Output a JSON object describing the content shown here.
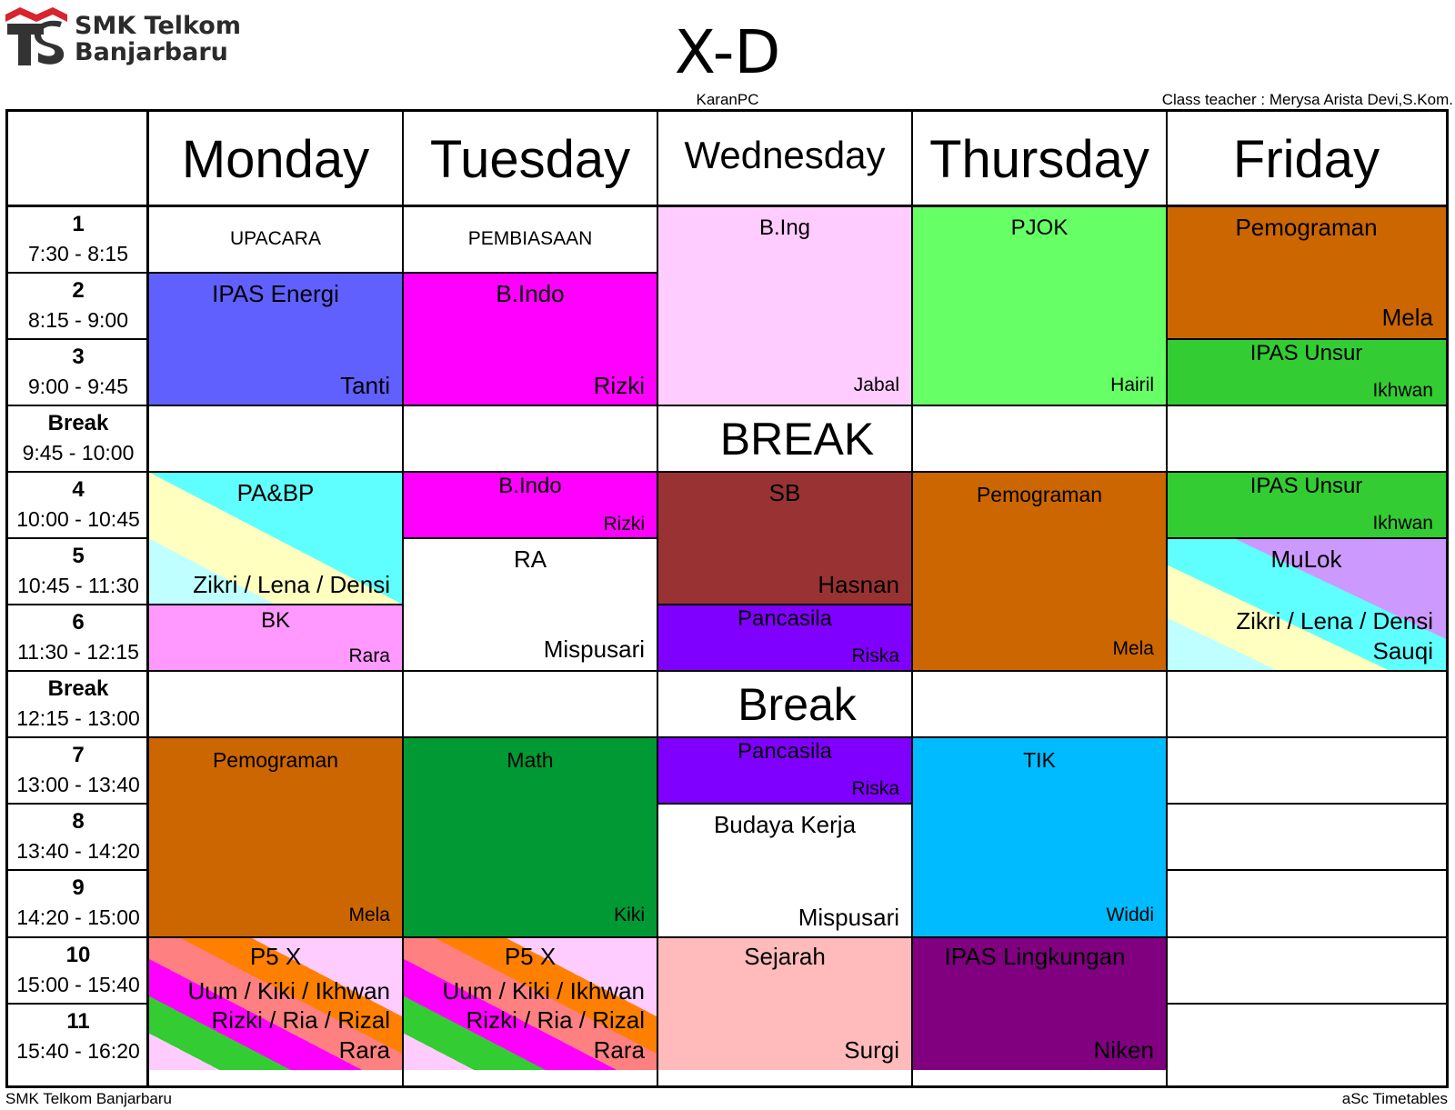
{
  "school": {
    "logo_line1": "SMK Telkom",
    "logo_line2": "Banjarbaru",
    "logo_icon": "telkom-school-logo",
    "accent": "#d9232d"
  },
  "class": {
    "name": "X-D",
    "author": "KaranPC",
    "teacher_label": "Class teacher : Merysa Arista Devi,S.Kom."
  },
  "days": [
    "Monday",
    "Tuesday",
    "Wednesday",
    "Thursday",
    "Friday"
  ],
  "periods": [
    {
      "num": "1",
      "time": "7:30 - 8:15"
    },
    {
      "num": "2",
      "time": "8:15 - 9:00"
    },
    {
      "num": "3",
      "time": "9:00 - 9:45"
    },
    {
      "num": "Break",
      "time": "9:45 - 10:00"
    },
    {
      "num": "4",
      "time": "10:00 - 10:45"
    },
    {
      "num": "5",
      "time": "10:45 - 11:30"
    },
    {
      "num": "6",
      "time": "11:30 - 12:15"
    },
    {
      "num": "Break",
      "time": "12:15 - 13:00"
    },
    {
      "num": "7",
      "time": "13:00 - 13:40"
    },
    {
      "num": "8",
      "time": "13:40 - 14:20"
    },
    {
      "num": "9",
      "time": "14:20 - 15:00"
    },
    {
      "num": "10",
      "time": "15:00 - 15:40"
    },
    {
      "num": "11",
      "time": "15:40 - 16:20"
    }
  ],
  "breaks": {
    "first": "BREAK",
    "second": "Break"
  },
  "lessons": {
    "mon_upacara": {
      "subject": "UPACARA"
    },
    "mon_ipas": {
      "subject": "IPAS Energi",
      "teacher": "Tanti",
      "color": "#6060ff"
    },
    "mon_pabp": {
      "subject": "PA&BP",
      "teacher": "Zikri / Lena / Densi",
      "colors": [
        "#c0ffff",
        "#ffffc0",
        "#60ffff"
      ]
    },
    "mon_bk": {
      "subject": "BK",
      "teacher": "Rara",
      "color": "#ff99ff"
    },
    "mon_pemo": {
      "subject": "Pemograman",
      "teacher": "Mela",
      "color": "#cc6600"
    },
    "mon_p5": {
      "subject": "P5 X",
      "line2": "Uum / Kiki / Ikhwan",
      "line3": "Rizki / Ria / Rizal",
      "teacher": "Rara",
      "colors": [
        "#ffccff",
        "#33cc33",
        "#ff00ff",
        "#ff8080",
        "#ff8000"
      ]
    },
    "tue_pembiasaan": {
      "subject": "PEMBIASAAN"
    },
    "tue_bindo1": {
      "subject": "B.Indo",
      "teacher": "Rizki",
      "color": "#ff00ff"
    },
    "tue_bindo2": {
      "subject": "B.Indo",
      "teacher": "Rizki",
      "color": "#ff00ff"
    },
    "tue_ra": {
      "subject": "RA",
      "teacher": "Mispusari"
    },
    "tue_math": {
      "subject": "Math",
      "teacher": "Kiki",
      "color": "#009933"
    },
    "tue_p5": {
      "subject": "P5 X",
      "line2": "Uum / Kiki / Ikhwan",
      "line3": "Rizki / Ria / Rizal",
      "teacher": "Rara"
    },
    "wed_bing": {
      "subject": "B.Ing",
      "teacher": "Jabal",
      "color": "#ffccff"
    },
    "wed_sb": {
      "subject": "SB",
      "teacher": "Hasnan",
      "color": "#993333"
    },
    "wed_pancasila1": {
      "subject": "Pancasila",
      "teacher": "Riska",
      "color": "#8000ff"
    },
    "wed_pancasila2": {
      "subject": "Pancasila",
      "teacher": "Riska",
      "color": "#8000ff"
    },
    "wed_budaya": {
      "subject": "Budaya Kerja",
      "teacher": "Mispusari"
    },
    "wed_sejarah": {
      "subject": "Sejarah",
      "teacher": "Surgi",
      "color": "#ffbbbb"
    },
    "thu_pjok": {
      "subject": "PJOK",
      "teacher": "Hairil",
      "color": "#66ff66"
    },
    "thu_pemo": {
      "subject": "Pemograman",
      "teacher": "Mela",
      "color": "#cc6600"
    },
    "thu_tik": {
      "subject": "TIK",
      "teacher": "Widdi",
      "color": "#00bbff"
    },
    "thu_ipasling": {
      "subject": "IPAS Lingkungan",
      "teacher": "Niken",
      "color": "#800080"
    },
    "fri_pemo": {
      "subject": "Pemograman",
      "teacher": "Mela",
      "color": "#cc6600"
    },
    "fri_ipas1": {
      "subject": "IPAS Unsur",
      "teacher": "Ikhwan",
      "color": "#33cc33"
    },
    "fri_ipas2": {
      "subject": "IPAS Unsur",
      "teacher": "Ikhwan",
      "color": "#33cc33"
    },
    "fri_mulok": {
      "subject": "MuLok",
      "teacher": "Zikri / Lena / Densi",
      "teacher2": "Sauqi",
      "colors": [
        "#c0ffff",
        "#ffffc0",
        "#60ffff",
        "#cc99ff"
      ]
    }
  },
  "footer": {
    "left": "SMK Telkom Banjarbaru",
    "right": "aSc Timetables"
  }
}
